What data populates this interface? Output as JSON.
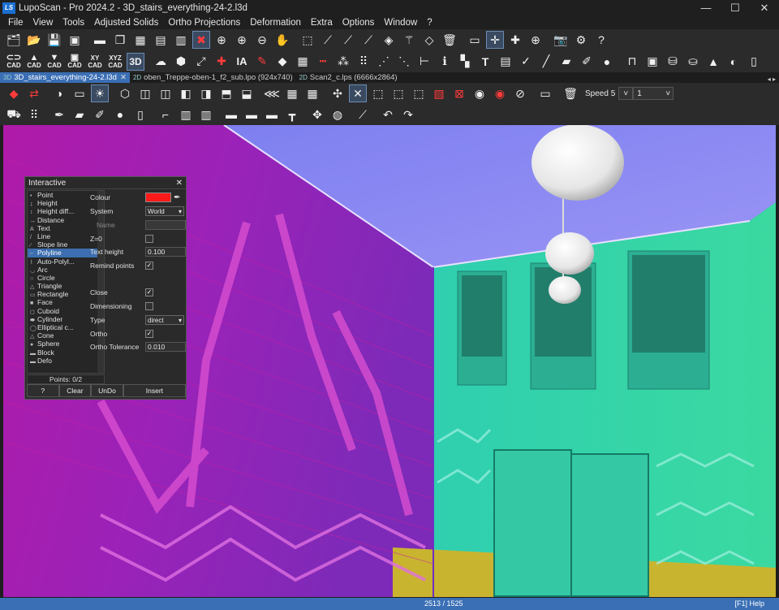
{
  "app": {
    "title": "LupoScan - Pro 2024.2 - 3D_stairs_everything-24-2.l3d",
    "logo": "LS"
  },
  "window_controls": {
    "minimize": "—",
    "maximize": "☐",
    "close": "✕"
  },
  "menu": [
    "File",
    "View",
    "Tools",
    "Adjusted Solids",
    "Ortho Projections",
    "Deformation",
    "Extra",
    "Options",
    "Window",
    "?"
  ],
  "toolbar1": [
    "folder-tree-icon",
    "open-folder-icon",
    "save-icon",
    "ls-save-icon",
    "folder-icon",
    "copy-layers-icon",
    "grid4-icon",
    "grid2h-icon",
    "grid2v-icon",
    "delete-view-icon",
    "zoom-in-icon",
    "zoom-window-icon",
    "zoom-out-icon",
    "pan-hand-icon",
    "select-rect-icon",
    "cut1-icon",
    "cut2-icon",
    "cut3-icon",
    "eraser-icon",
    "wand-icon",
    "eraser2-icon",
    "trash-icon",
    "ruler-icon",
    "crosshair-icon",
    "crosshair2-icon",
    "target-icon",
    "camera-icon",
    "gear-icon",
    "help-icon"
  ],
  "toolbar2": {
    "cad_labels": [
      "CAD",
      "CAD",
      "CAD",
      "CAD",
      "CAD",
      "CAD"
    ],
    "xy_label": "XY",
    "xyz_label": "XYZ",
    "threed_label": "3D",
    "ia_label": "IA",
    "t_label": "T"
  },
  "tabs": [
    {
      "type": "3D",
      "label": "3D_stairs_everything-24-2.l3d",
      "active": true
    },
    {
      "type": "2D",
      "label": "oben_Treppe-oben-1_f2_sub.lpo (924x740)",
      "active": false
    },
    {
      "type": "2D",
      "label": "Scan2_c.lps (6666x2864)",
      "active": false
    }
  ],
  "speed": {
    "label": "Speed 5",
    "value": "1"
  },
  "interactive_panel": {
    "title": "Interactive",
    "items": [
      {
        "icon": "•",
        "label": "Point"
      },
      {
        "icon": "↨",
        "label": "Height"
      },
      {
        "icon": "↕",
        "label": "Height diff..."
      },
      {
        "icon": "↔",
        "label": "Distance"
      },
      {
        "icon": "A",
        "label": "Text"
      },
      {
        "icon": "/",
        "label": "Line"
      },
      {
        "icon": "∕",
        "label": "Slope line"
      },
      {
        "icon": "⌐",
        "label": "Polyline"
      },
      {
        "icon": "⌇",
        "label": "Auto-Polyl..."
      },
      {
        "icon": "◡",
        "label": "Arc"
      },
      {
        "icon": "○",
        "label": "Circle"
      },
      {
        "icon": "△",
        "label": "Triangle"
      },
      {
        "icon": "▭",
        "label": "Rectangle"
      },
      {
        "icon": "■",
        "label": "Face"
      },
      {
        "icon": "◻",
        "label": "Cuboid"
      },
      {
        "icon": "⬬",
        "label": "Cylinder"
      },
      {
        "icon": "◯",
        "label": "Elliptical c..."
      },
      {
        "icon": "△",
        "label": "Cone"
      },
      {
        "icon": "●",
        "label": "Sphere"
      },
      {
        "icon": "▬",
        "label": "Block"
      },
      {
        "icon": "▬",
        "label": "Defo"
      }
    ],
    "selected_index": 7,
    "points": "Points: 0/2",
    "props": {
      "colour_label": "Colour",
      "colour_value": "#ff1a1a",
      "system_label": "System",
      "system_value": "World",
      "name_label": "Name",
      "z0_label": "Z=0",
      "text_height_label": "Text height",
      "text_height_value": "0.100",
      "remind_label": "Remind points",
      "close_label": "Close",
      "dimensioning_label": "Dimensioning",
      "type_label": "Type",
      "type_value": "direct",
      "ortho_label": "Ortho",
      "ortho_tol_label": "Ortho Tolerance",
      "ortho_tol_value": "0.010",
      "checkmark": "✓"
    },
    "buttons": [
      "?",
      "Clear",
      "UnDo",
      "Insert"
    ]
  },
  "status": {
    "coords": "2513 / 1525",
    "help": "[F1] Help"
  },
  "colors": {
    "accent": "#3a6fb5",
    "wall_left": "#a01fb0",
    "ceiling": "#8a87f0",
    "wall_right": "#30c9a8"
  }
}
